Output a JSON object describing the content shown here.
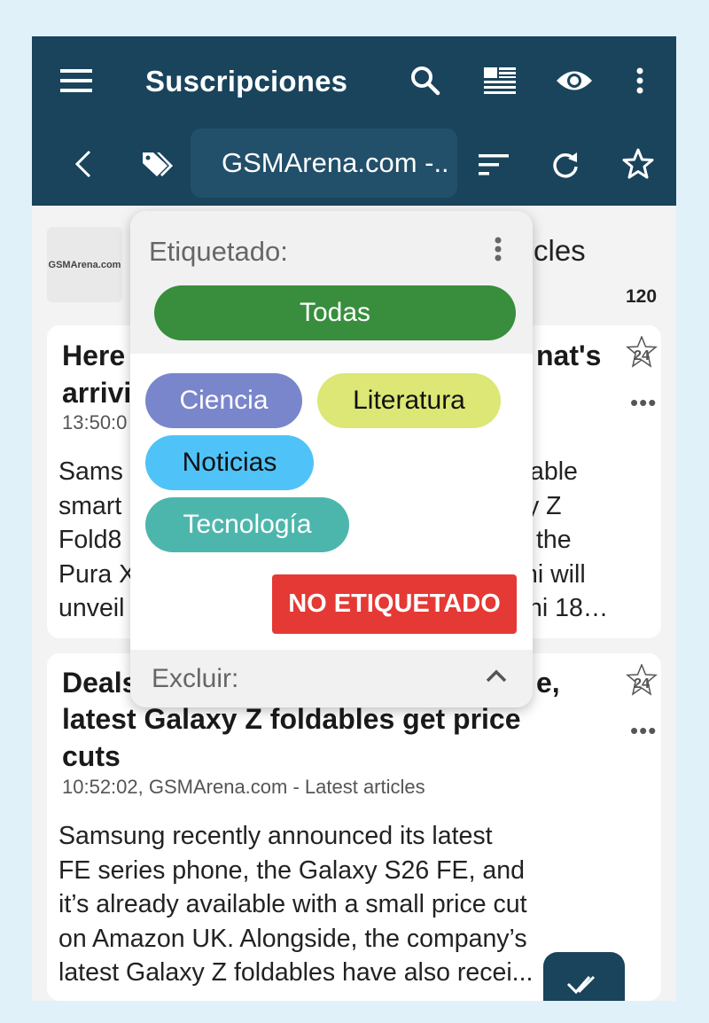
{
  "appbar": {
    "title": "Suscripciones",
    "feed_selector": "GSMArena.com -..",
    "icons": [
      "menu-icon",
      "search-icon",
      "view-list-icon",
      "eye-icon",
      "more-vert-icon",
      "back-icon",
      "tag-icon",
      "sort-icon",
      "refresh-icon",
      "star-icon"
    ],
    "color": "#19445c"
  },
  "feed_header": {
    "logo_text": "GSMArena.com",
    "title_visible": "cles",
    "count": "120"
  },
  "articles": [
    {
      "title_lines": [
        "Here",
        "arrivi"
      ],
      "title_right_line1": "nat's",
      "meta": "13:50:0",
      "body_left": [
        "Sams",
        "smart",
        "Fold8",
        "Pura X",
        "unveil"
      ],
      "body_right": [
        "able",
        "y Z",
        "the",
        "ni will",
        "ni 18…"
      ],
      "badge": "24"
    },
    {
      "title_lines": [
        "Deals",
        "latest Galaxy Z foldables get price",
        "cuts"
      ],
      "title_right_line1": "e,",
      "meta": "10:52:02, GSMArena.com - Latest articles",
      "body": [
        "Samsung recently announced its latest",
        "FE series phone, the Galaxy S26 FE, and",
        "it’s already available with a small price cut",
        "on Amazon UK. Alongside, the company’s",
        "latest Galaxy Z foldables have also recei..."
      ],
      "badge": "24"
    }
  ],
  "tag_popup": {
    "label": "Etiquetado:",
    "all_label": "Todas",
    "tags": [
      {
        "label": "Ciencia",
        "color": "#7986cb",
        "text_color": "#ffffff"
      },
      {
        "label": "Literatura",
        "color": "#dce775",
        "text_color": "#111111"
      },
      {
        "label": "Noticias",
        "color": "#4fc3f7",
        "text_color": "#111111"
      },
      {
        "label": "Tecnología",
        "color": "#4db6ac",
        "text_color": "#ffffff"
      }
    ],
    "untagged_label": "NO ETIQUETADO",
    "exclude_label": "Excluir:",
    "colors": {
      "all": "#388e3c",
      "untagged": "#e53935"
    }
  },
  "fab": {
    "icon": "done-all-icon"
  }
}
